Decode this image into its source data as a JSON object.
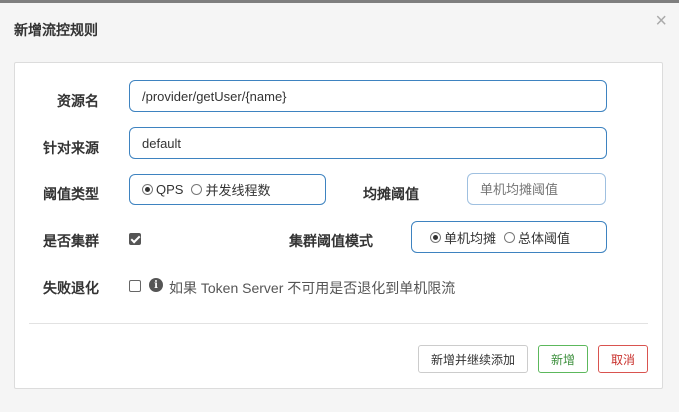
{
  "dialog": {
    "title": "新增流控规则",
    "close_glyph": "×"
  },
  "form": {
    "resource": {
      "label": "资源名",
      "value": "/provider/getUser/{name}"
    },
    "limit_app": {
      "label": "针对来源",
      "value": "default"
    },
    "grade": {
      "label": "阈值类型",
      "options": [
        {
          "label": "QPS",
          "selected": true
        },
        {
          "label": "并发线程数",
          "selected": false
        }
      ]
    },
    "share_threshold": {
      "label": "均摊阈值",
      "placeholder": "单机均摊阈值"
    },
    "cluster": {
      "label": "是否集群",
      "checked": true
    },
    "cluster_mode": {
      "label": "集群阈值模式",
      "options": [
        {
          "label": "单机均摊",
          "selected": true
        },
        {
          "label": "总体阈值",
          "selected": false
        }
      ]
    },
    "fallback": {
      "label": "失败退化",
      "checked": false,
      "help_text": "如果 Token Server 不可用是否退化到单机限流"
    }
  },
  "footer": {
    "add_continue_label": "新增并继续添加",
    "add_label": "新增",
    "cancel_label": "取消"
  },
  "colors": {
    "input_border": "#3e83c0",
    "success": "#5cb85c",
    "danger": "#d9534f"
  }
}
